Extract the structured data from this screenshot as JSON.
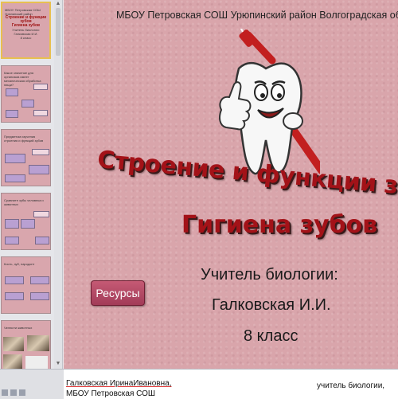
{
  "slide": {
    "school": "МБОУ Петровская СОШ Урюпинский район Волгоградская область",
    "title_line1": "Строение и функции зубо",
    "title_line2": "Гигиена зубов",
    "teacher_role": "Учитель биологии:",
    "teacher_name": "Галковская И.И.",
    "grade": "8 класс",
    "resources_button": "Ресурсы"
  },
  "thumbnails": [
    {
      "index": 1,
      "active": true,
      "lines": [
        "МБОУ Петровская СОШ Урюпинский район",
        "Строение и функции зубов",
        "Гигиена зубов",
        "Учитель биологии:",
        "Галковская И.И.",
        "8 класс"
      ]
    },
    {
      "index": 2,
      "active": false,
      "lines": [
        "Какое значение для организма имеет",
        "механическая обработка пищи?"
      ]
    },
    {
      "index": 3,
      "active": false,
      "lines": [
        "Предметом изучения строения и функций зубов"
      ]
    },
    {
      "index": 4,
      "active": false,
      "lines": [
        "Сравните зубы человека и животных"
      ]
    },
    {
      "index": 5,
      "active": false,
      "lines": [
        "Кость, зуб, пародонт"
      ]
    },
    {
      "index": 6,
      "active": false,
      "lines": [
        "Челюсти животных"
      ]
    }
  ],
  "notes": {
    "line1": "Галковская ИринаИвановна,",
    "right": "учитель биологии,",
    "line2": "МБОУ Петровская СОШ"
  },
  "colors": {
    "slide_bg": "#d9a5ab",
    "title": "#a31218",
    "button": "#b04863"
  }
}
